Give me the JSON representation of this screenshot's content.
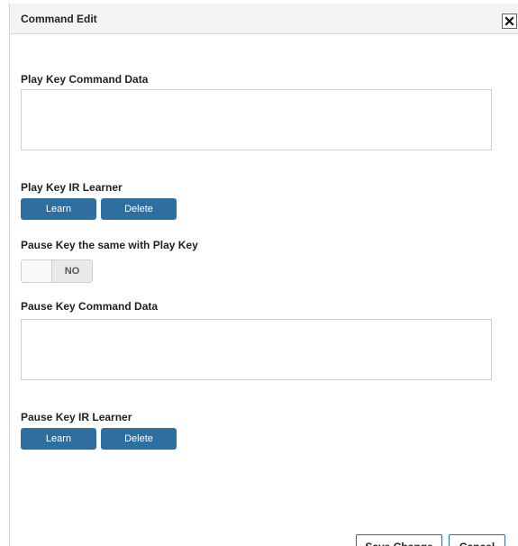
{
  "dialog": {
    "title": "Command Edit",
    "close_icon": "close-icon"
  },
  "play": {
    "command_label": "Play Key Command Data",
    "command_value": "",
    "ir_label": "Play Key IR Learner",
    "learn_label": "Learn",
    "delete_label": "Delete"
  },
  "pause_same": {
    "label": "Pause Key the same with Play Key",
    "toggle_value": "NO"
  },
  "pause": {
    "command_label": "Pause Key Command Data",
    "command_value": "",
    "ir_label": "Pause Key IR Learner",
    "learn_label": "Learn",
    "delete_label": "Delete"
  },
  "footer": {
    "save_label": "Save Change",
    "cancel_label": "Cancel"
  },
  "colors": {
    "primary_button": "#2f6f9f",
    "titlebar": "#f3f3f3"
  }
}
